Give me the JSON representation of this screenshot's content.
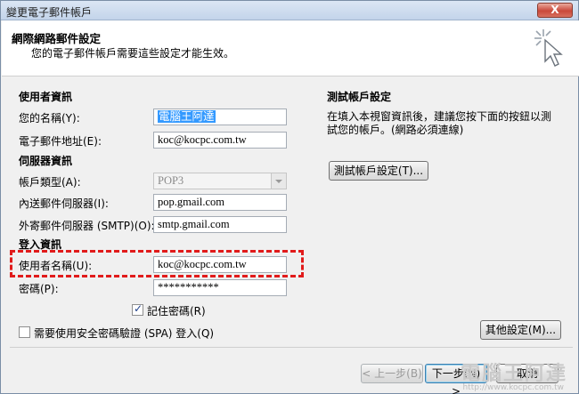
{
  "window": {
    "title": "變更電子郵件帳戶",
    "close_label": "X"
  },
  "header": {
    "title": "網際網路郵件設定",
    "description": "您的電子郵件帳戶需要這些設定才能生效。",
    "icon": "cursor-click-icon"
  },
  "user_info": {
    "section_title": "使用者資訊",
    "name_label": "您的名稱(Y):",
    "name_value": "電腦王阿達",
    "email_label": "電子郵件地址(E):",
    "email_value": "koc@kocpc.com.tw"
  },
  "server_info": {
    "section_title": "伺服器資訊",
    "account_type_label": "帳戶類型(A):",
    "account_type_value": "POP3",
    "incoming_label": "內送郵件伺服器(I):",
    "incoming_value": "pop.gmail.com",
    "outgoing_label": "外寄郵件伺服器 (SMTP)(O):",
    "outgoing_value": "smtp.gmail.com"
  },
  "login_info": {
    "section_title": "登入資訊",
    "username_label": "使用者名稱(U):",
    "username_value": "koc@kocpc.com.tw",
    "password_label": "密碼(P):",
    "password_value": "***********",
    "remember_label": "記住密碼(R)",
    "remember_checked": true,
    "spa_label": "需要使用安全密碼驗證 (SPA) 登入(Q)",
    "spa_checked": false
  },
  "test_settings": {
    "section_title": "測試帳戶設定",
    "description": "在填入本視窗資訊後，建議您按下面的按鈕以測試您的帳戶。(網路必須連線)",
    "test_button": "測試帳戶設定(T)..."
  },
  "buttons": {
    "more_settings": "其他設定(M)...",
    "back": "< 上一步(B)",
    "next": "下一步(N) >",
    "cancel": "取消"
  },
  "watermark": {
    "text": "電腦王阿達",
    "url": "http://www.kocpc.com.tw"
  },
  "colors": {
    "highlight": "#e11b1b",
    "selection": "#3399ff"
  }
}
